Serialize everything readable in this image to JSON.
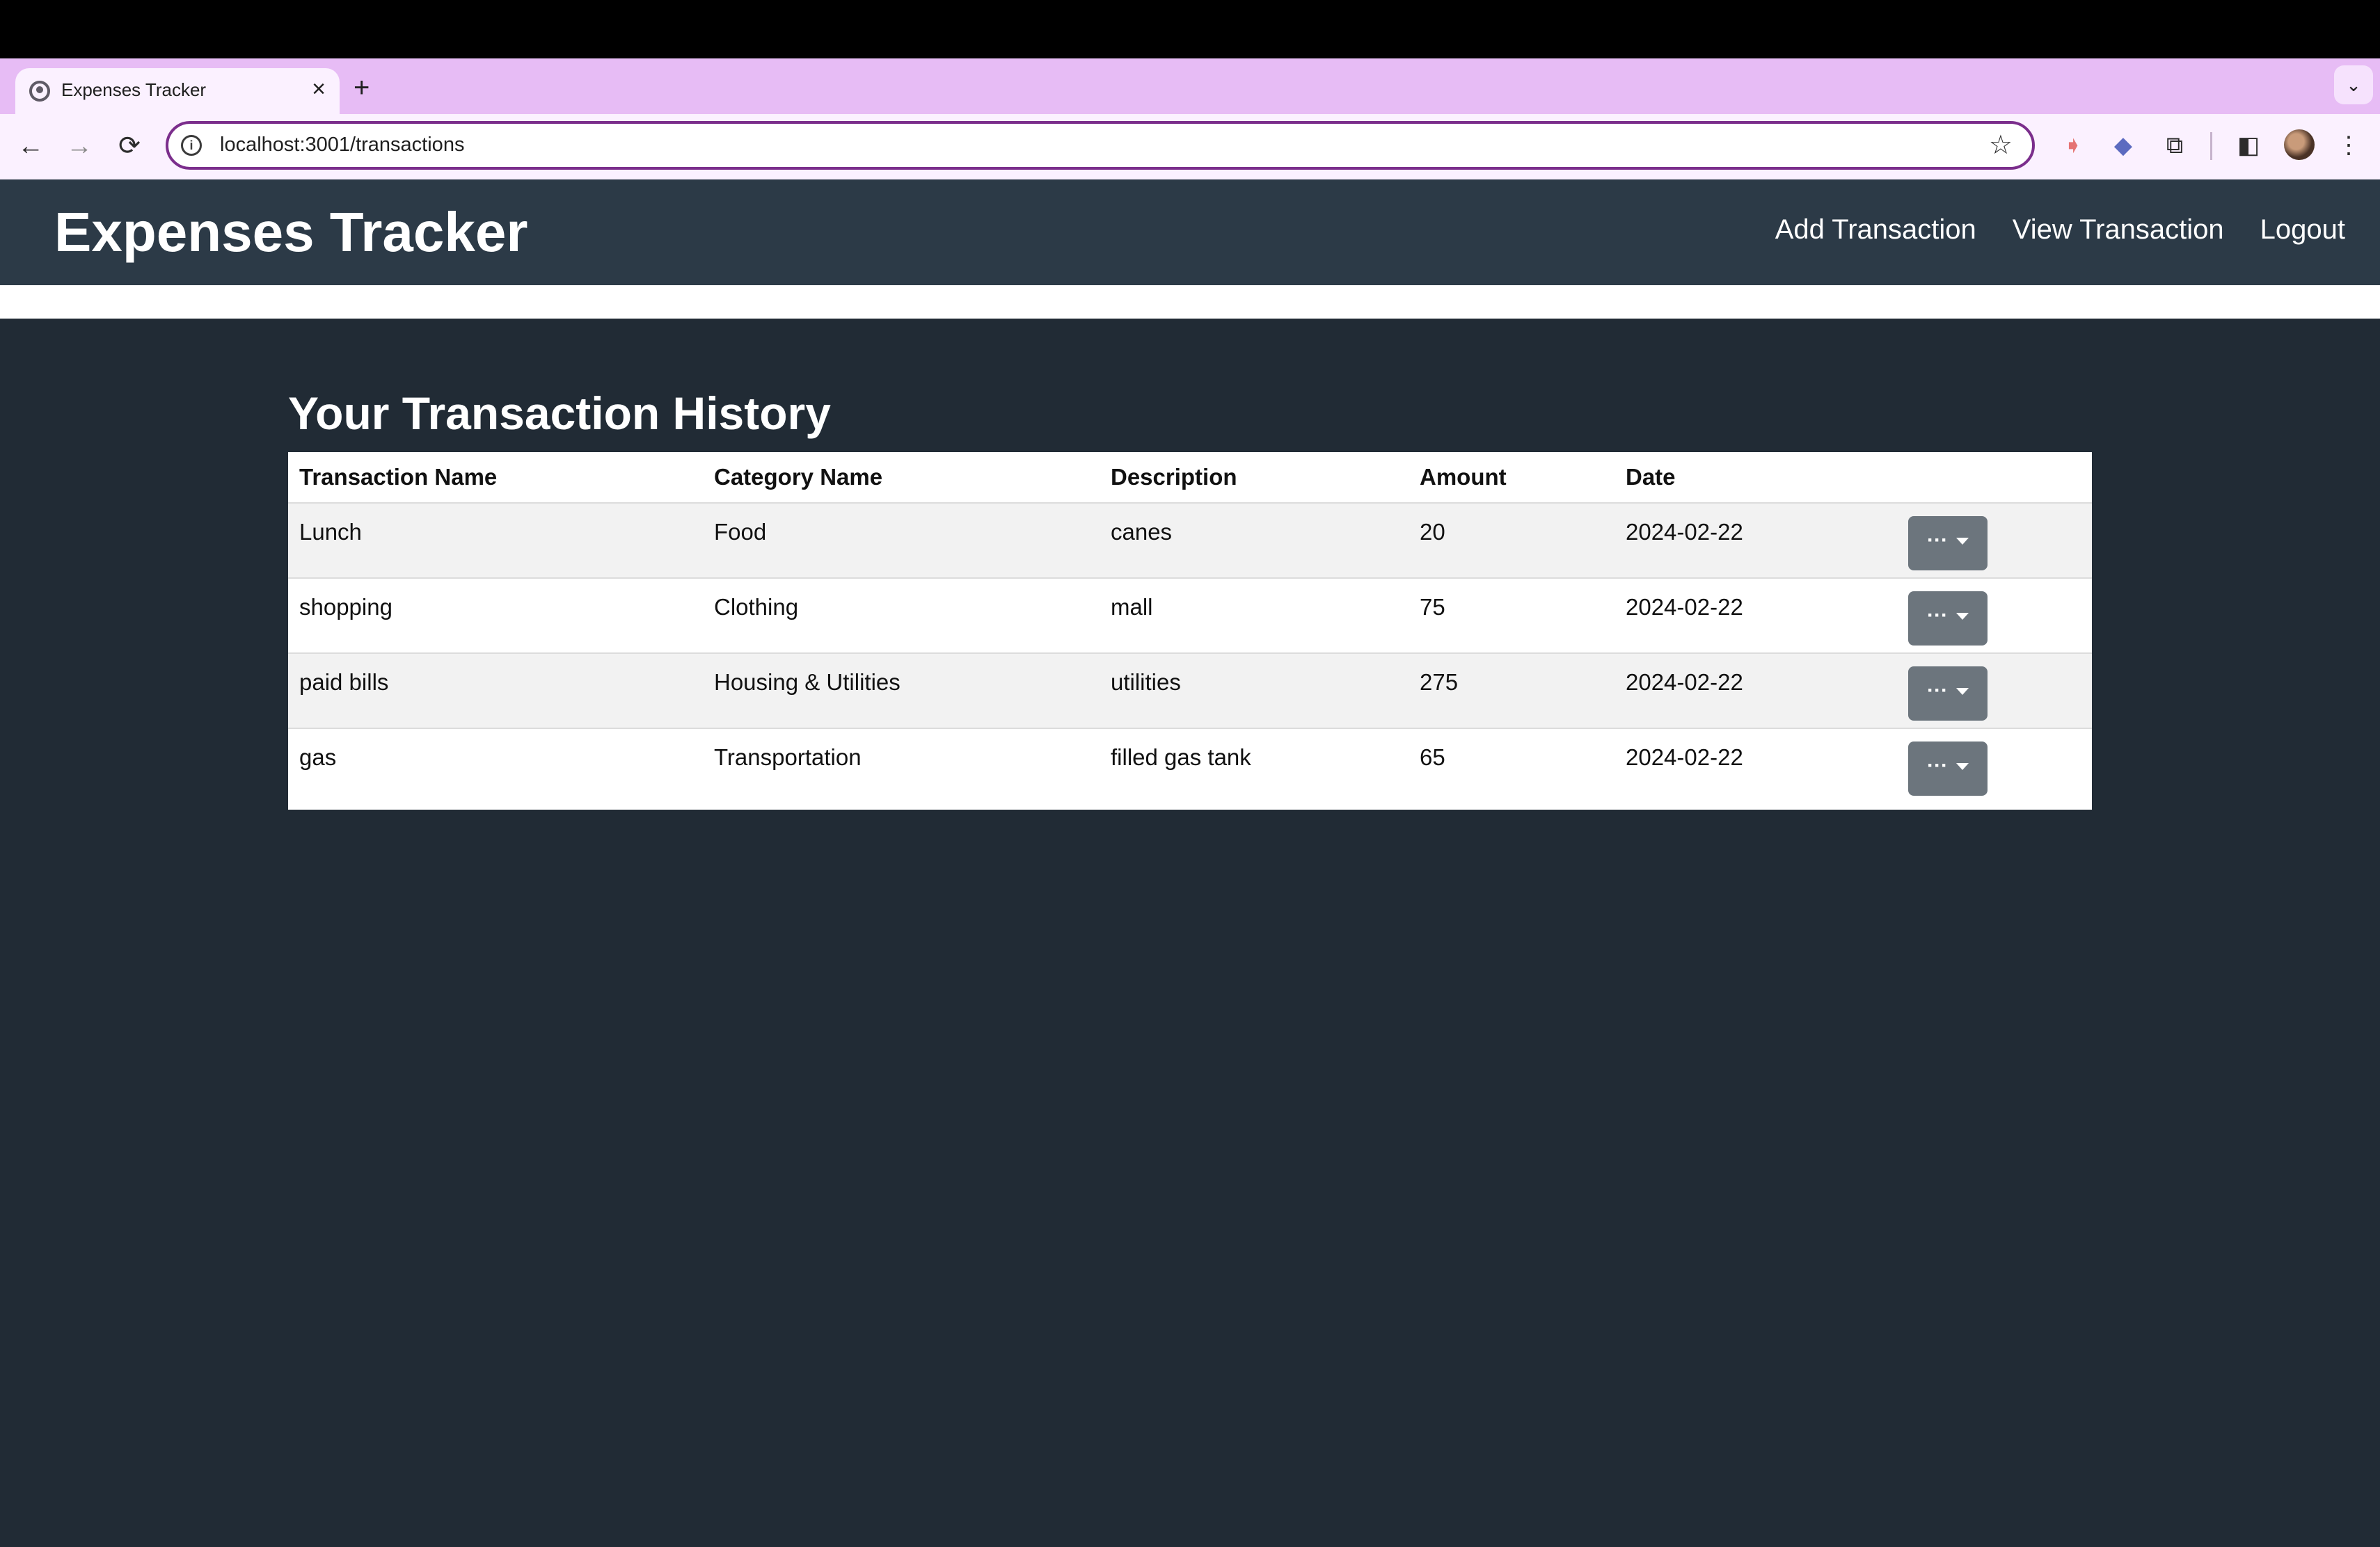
{
  "browser": {
    "tab_title": "Expenses Tracker",
    "tab_close": "×",
    "new_tab": "+",
    "tab_menu": "⌄",
    "url": "localhost:3001/transactions",
    "back": "←",
    "forward": "→",
    "reload": "⟳",
    "star": "☆",
    "info_icon": "i",
    "menu": "⋮"
  },
  "app": {
    "brand": "Expenses Tracker",
    "nav": {
      "add": "Add Transaction",
      "view": "View Transaction",
      "logout": "Logout"
    }
  },
  "main": {
    "title": "Your Transaction History",
    "columns": [
      "Transaction Name",
      "Category Name",
      "Description",
      "Amount",
      "Date"
    ],
    "rows": [
      {
        "name": "Lunch",
        "category": "Food",
        "description": "canes",
        "amount": "20",
        "date": "2024-02-22"
      },
      {
        "name": "shopping",
        "category": "Clothing",
        "description": "mall",
        "amount": "75",
        "date": "2024-02-22"
      },
      {
        "name": "paid bills",
        "category": "Housing & Utilities",
        "description": "utilities",
        "amount": "275",
        "date": "2024-02-22"
      },
      {
        "name": "gas",
        "category": "Transportation",
        "description": "filled gas tank",
        "amount": "65",
        "date": "2024-02-22"
      }
    ],
    "action_label": "···"
  },
  "colors": {
    "page_bg": "#212b35",
    "navbar_bg": "#2c3a47",
    "tabstrip_bg": "#e7bcf5",
    "omnibox_border": "#7b2e8c",
    "action_button": "#6c757d"
  }
}
